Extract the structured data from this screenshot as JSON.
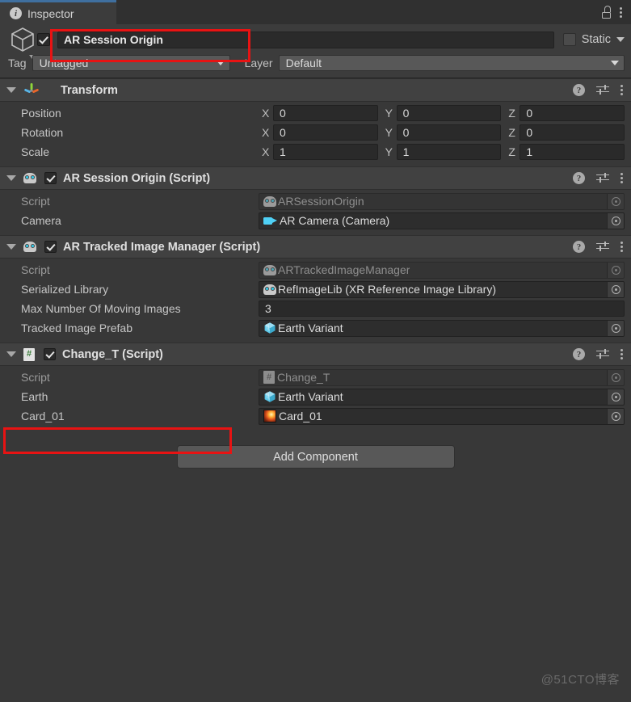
{
  "window": {
    "tab_label": "Inspector",
    "tab_icon": "info-icon",
    "lock_icon": "lock-icon",
    "menu_icon": "kebab-menu-icon"
  },
  "gameobject": {
    "enabled": true,
    "name": "AR Session Origin",
    "static_label": "Static",
    "static_checked": false,
    "tag_label": "Tag",
    "tag_value": "Untagged",
    "layer_label": "Layer",
    "layer_value": "Default",
    "icon": "cube-icon"
  },
  "components": [
    {
      "title": "Transform",
      "icon": "transform-gizmo-icon",
      "has_checkbox": false,
      "expanded": true,
      "vectors": [
        {
          "label": "Position",
          "x": "0",
          "y": "0",
          "z": "0"
        },
        {
          "label": "Rotation",
          "x": "0",
          "y": "0",
          "z": "0"
        },
        {
          "label": "Scale",
          "x": "1",
          "y": "1",
          "z": "1"
        }
      ],
      "axis_labels": {
        "x": "X",
        "y": "Y",
        "z": "Z"
      }
    },
    {
      "title": "AR Session Origin (Script)",
      "icon": "unity-script-robot-icon",
      "has_checkbox": true,
      "checked": true,
      "expanded": true,
      "fields": [
        {
          "label": "Script",
          "value": "ARSessionOrigin",
          "icon": "unity-script-robot-icon",
          "disabled": true
        },
        {
          "label": "Camera",
          "value": "AR Camera (Camera)",
          "icon": "camera-icon",
          "disabled": false
        }
      ]
    },
    {
      "title": "AR Tracked Image Manager (Script)",
      "icon": "unity-script-robot-icon",
      "has_checkbox": true,
      "checked": true,
      "expanded": true,
      "fields": [
        {
          "label": "Script",
          "value": "ARTrackedImageManager",
          "icon": "unity-script-robot-icon",
          "disabled": true
        },
        {
          "label": "Serialized Library",
          "value": "RefImageLib (XR Reference Image Library)",
          "icon": "unity-script-robot-icon",
          "disabled": false
        },
        {
          "label": "Max Number Of Moving Images",
          "value": "3",
          "icon": "none",
          "type": "number"
        },
        {
          "label": "Tracked Image Prefab",
          "value": "Earth Variant",
          "icon": "prefab-cube-icon",
          "disabled": false
        }
      ]
    },
    {
      "title": "Change_T (Script)",
      "icon": "csharp-script-icon",
      "has_checkbox": true,
      "checked": true,
      "expanded": true,
      "highlighted": true,
      "fields": [
        {
          "label": "Script",
          "value": "Change_T",
          "icon": "csharp-script-icon",
          "disabled": true
        },
        {
          "label": "Earth",
          "value": "Earth Variant",
          "icon": "prefab-cube-icon",
          "disabled": false
        },
        {
          "label": "Card_01",
          "value": "Card_01",
          "icon": "texture-thumbnail-icon",
          "disabled": false
        }
      ]
    }
  ],
  "component_header_icons": {
    "help": "?",
    "help_name": "help-icon",
    "preset": "preset-settings-icon",
    "menu": "kebab-menu-icon"
  },
  "add_component": {
    "label": "Add Component"
  },
  "watermark": {
    "text": "@51CTO博客"
  },
  "colors": {
    "accent_blue": "#3f6f9f",
    "annotation_red": "#e81313",
    "panel_bg": "#383838",
    "header_bg": "#414141",
    "field_bg": "#2a2a2a"
  }
}
